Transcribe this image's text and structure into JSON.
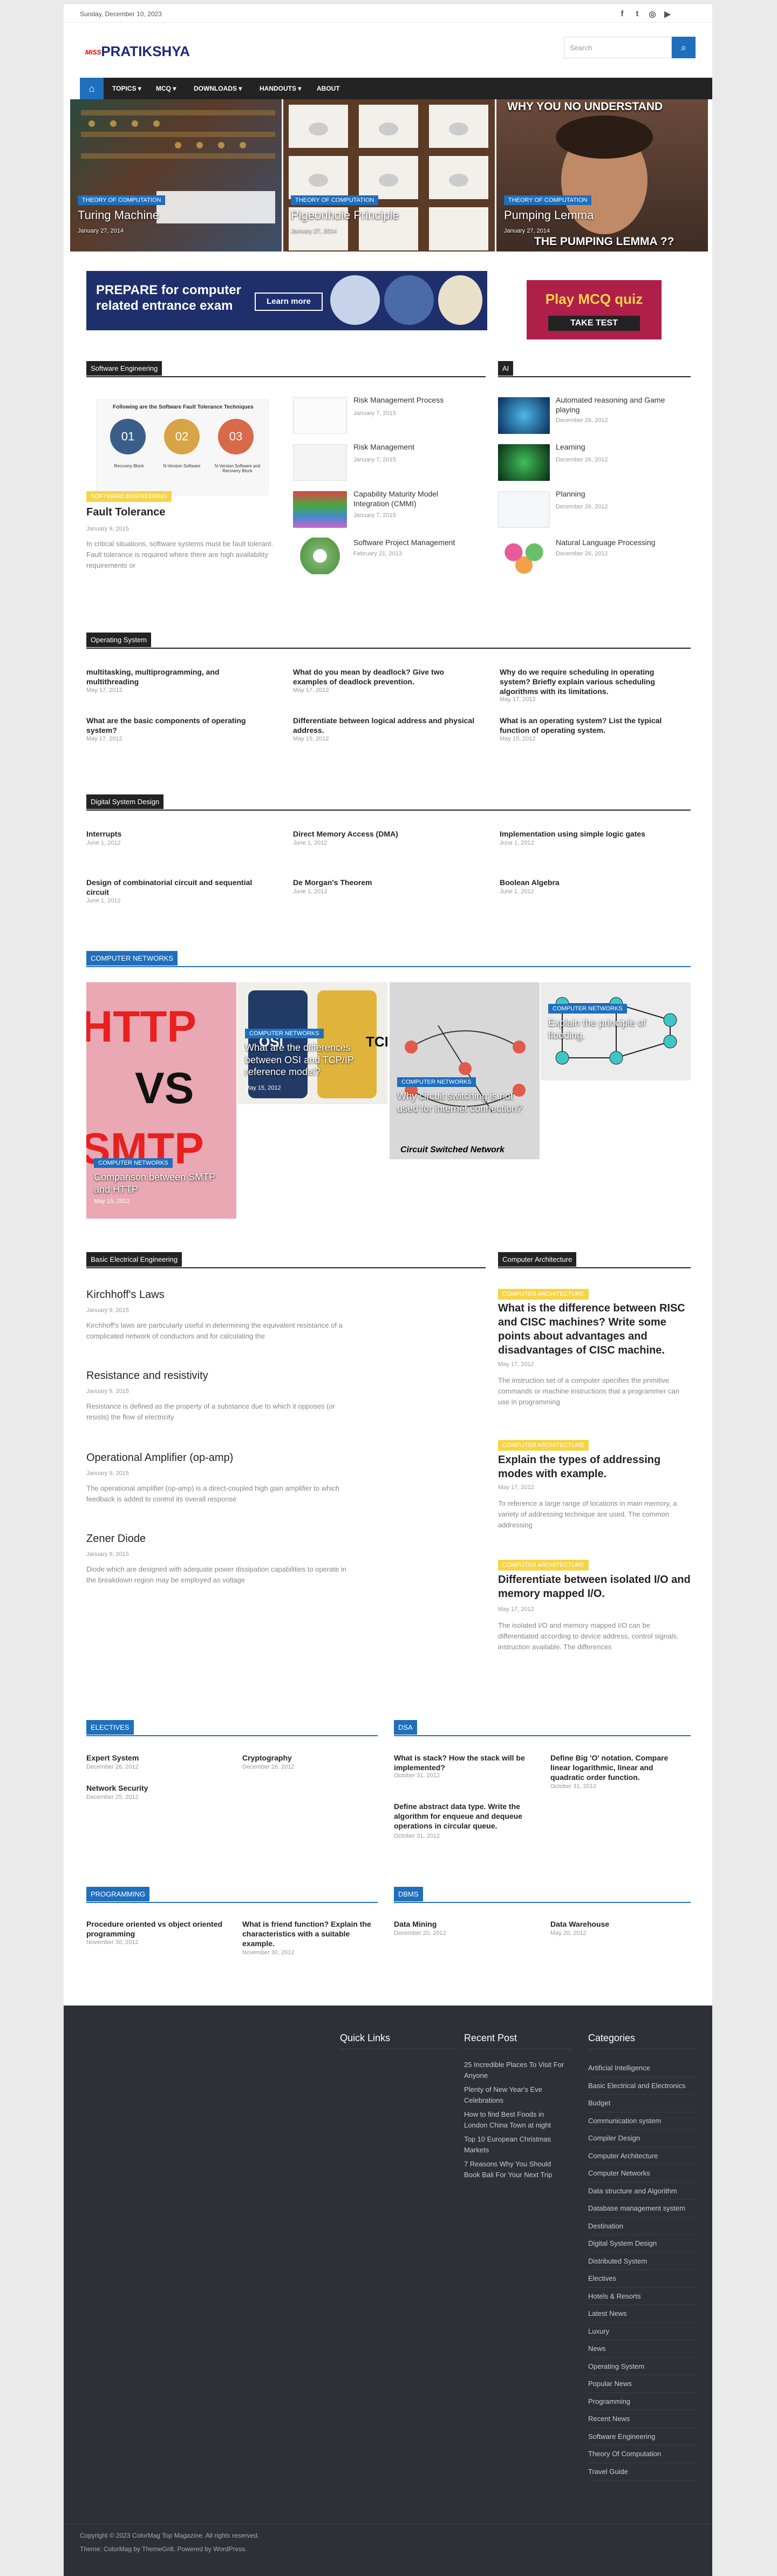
{
  "topbar": {
    "date": "Sunday, December 10, 2023",
    "social": [
      "facebook-icon",
      "twitter-icon",
      "instagram-icon",
      "youtube-icon"
    ]
  },
  "brand": {
    "logo_small": "MISS",
    "logo": "PRATIKSHYA"
  },
  "search": {
    "placeholder": "Search"
  },
  "nav": [
    "TOPICS",
    "MCQ",
    "DOWNLOADS",
    "HANDOUTS",
    "ABOUT"
  ],
  "slider": [
    {
      "cat": "THEORY OF COMPUTATION",
      "title": "Turing Machine",
      "date": "January 27, 2014"
    },
    {
      "cat": "THEORY OF COMPUTATION",
      "title": "Pigeonhole Principle",
      "date": "January 27, 2014"
    },
    {
      "cat": "THEORY OF COMPUTATION",
      "title": "Pumping Lemma",
      "date": "January 27, 2014",
      "img_text": "WHY YOU NO UNDERSTAND",
      "img_text2": "THE PUMPING LEMMA ??"
    }
  ],
  "ads": {
    "banner1": "PREPARE for computer related entrance exam",
    "banner1_btn": "Learn more",
    "banner2": "Play MCQ quiz",
    "banner2_btn": "TAKE TEST"
  },
  "se": {
    "title": "Software Engineering",
    "main": {
      "tag": "SOFTWARE ENGINEERING",
      "title": "Fault Tolerance",
      "date": "January 9, 2015",
      "excerpt": "In critical situations, software systems must be fault tolerant. Fault tolerance is required where there are high availability requirements or",
      "img_title": "Following are the Software Fault Tolerance Techniques",
      "img_labels": [
        "Recovery Block",
        "N-Version Software",
        "N-Version Software and Recovery Block"
      ],
      "img_nums": [
        "01",
        "02",
        "03"
      ]
    },
    "items": [
      {
        "title": "Risk Management Process",
        "date": "January 7, 2015"
      },
      {
        "title": "Risk Management",
        "date": "January 7, 2015"
      },
      {
        "title": "Capability Maturity Model Integration (CMMI)",
        "date": "January 7, 2015"
      },
      {
        "title": "Software Project Management",
        "date": "February 21, 2013"
      }
    ]
  },
  "ai": {
    "title": "AI",
    "items": [
      {
        "title": "Automated reasoning and Game playing",
        "date": "December 26, 2012"
      },
      {
        "title": "Learning",
        "date": "December 26, 2012"
      },
      {
        "title": "Planning",
        "date": "December 26, 2012"
      },
      {
        "title": "Natural Language Processing",
        "date": "December 26, 2012"
      }
    ]
  },
  "os": {
    "title": "Operating System",
    "items": [
      {
        "title": "multitasking, multiprogramming, and multithreading",
        "date": "May 17, 2012"
      },
      {
        "title": "What do you mean by deadlock? Give two examples of deadlock prevention.",
        "date": "May 17, 2012"
      },
      {
        "title": "Why do we require scheduling in operating system? Briefly explain various scheduling algorithms with its limitations.",
        "date": "May 17, 2012"
      },
      {
        "title": "What are the basic components of operating system?",
        "date": "May 17, 2012"
      },
      {
        "title": "Differentiate between logical address and physical address.",
        "date": "May 15, 2012"
      },
      {
        "title": "What is an operating system? List the typical function of operating system.",
        "date": "May 15, 2012"
      }
    ]
  },
  "dsd": {
    "title": "Digital System Design",
    "items": [
      {
        "title": "Interrupts",
        "date": "June 1, 2012"
      },
      {
        "title": "Direct Memory Access (DMA)",
        "date": "June 1, 2012"
      },
      {
        "title": "Implementation using simple logic gates",
        "date": "June 1, 2012"
      },
      {
        "title": "Design of combinatorial circuit and sequential circuit",
        "date": "June 1, 2012"
      },
      {
        "title": "De Morgan's Theorem",
        "date": "June 1, 2012"
      },
      {
        "title": "Boolean Algebra",
        "date": "June 1, 2012"
      }
    ]
  },
  "cn": {
    "title": "COMPUTER NETWORKS",
    "items": [
      {
        "cat": "COMPUTER NETWORKS",
        "title": "Comparison between SMTP and HTTP",
        "date": "May 15, 2012",
        "img_top": "HTTP",
        "img_mid": "VS",
        "img_bot": "SMTP"
      },
      {
        "cat": "COMPUTER NETWORKS",
        "title": "What are the differences between OSI and TCP/IP reference model?",
        "date": "May 15, 2012",
        "img_a": "OSI",
        "img_b": "TCP"
      },
      {
        "cat": "COMPUTER NETWORKS",
        "title": "Why circuit switching is not used for internet connection?",
        "date": "May 15, 2012",
        "img_caption": "Circuit Switched Network"
      },
      {
        "cat": "COMPUTER NETWORKS",
        "title": "Explain the principle of flooding.",
        "date": "May 15, 2012"
      }
    ]
  },
  "bee": {
    "title": "Basic Electrical Engineering",
    "items": [
      {
        "title": "Kirchhoff's Laws",
        "date": "January 9, 2015",
        "excerpt": "Kirchhoff's laws are particularly useful in determining the equivalent resistance of a complicated network of conductors and for calculating the"
      },
      {
        "title": "Resistance and resistivity",
        "date": "January 9, 2015",
        "excerpt": "Resistance is defined as the property of a substance due to which it opposes (or resists) the flow of electricity"
      },
      {
        "title": "Operational Amplifier (op-amp)",
        "date": "January 9, 2015",
        "excerpt": "The operational amplifier (op-amp) is a direct-coupled high gain amplifier to which feedback is added to control its overall response"
      },
      {
        "title": "Zener Diode",
        "date": "January 9, 2015",
        "excerpt": "Diode which are designed with adequate power dissipation capabilities to operate in the breakdown region may be employed as voltage"
      }
    ]
  },
  "ca": {
    "title": "Computer Architecture",
    "items": [
      {
        "tag": "COMPUTER ARCHITECTURE",
        "title": "What is the difference between RISC and CISC machines? Write some points about advantages and disadvantages of CISC machine.",
        "date": "May 17, 2012",
        "excerpt": "The instruction set of a computer specifies the primitive commands or machine instructions that a programmer can use in programming"
      },
      {
        "tag": "COMPUTER ARCHITECTURE",
        "title": "Explain the types of addressing modes with example.",
        "date": "May 17, 2012",
        "excerpt": "To reference a large range of locations in main memory, a variety of addressing technique are used. The common addressing"
      },
      {
        "tag": "COMPUTER ARCHITECTURE",
        "title": "Differentiate between isolated I/O and memory mapped I/O.",
        "date": "May 17, 2012",
        "excerpt": "The  isolated I/O  and memory mapped I/O can be differentiated according to device address, control signals, instruction available. The differences"
      }
    ]
  },
  "electives": {
    "title": "ELECTIVES",
    "items": [
      {
        "title": "Expert System",
        "date": "December 26, 2012"
      },
      {
        "title": "Cryptography",
        "date": "December 26, 2012"
      },
      {
        "title": "Network Security",
        "date": "December 25, 2012"
      }
    ]
  },
  "dsa": {
    "title": "DSA",
    "items": [
      {
        "title": "What is stack? How the stack will be implemented?",
        "date": "October 31, 2012"
      },
      {
        "title": "Define Big 'O' notation. Compare linear logarithmic, linear and quadratic order function.",
        "date": "October 31, 2012"
      },
      {
        "title": "Define abstract data type. Write the algorithm for enqueue and dequeue operations in circular queue.",
        "date": "October 31, 2012"
      }
    ]
  },
  "prog": {
    "title": "PROGRAMMING",
    "items": [
      {
        "title": "Procedure oriented vs object oriented programming",
        "date": "November 30, 2012"
      },
      {
        "title": "What is friend function? Explain the characteristics with a suitable example.",
        "date": "November 30, 2012"
      }
    ]
  },
  "dbms": {
    "title": "DBMS",
    "items": [
      {
        "title": "Data Mining",
        "date": "December 20, 2012"
      },
      {
        "title": "Data Warehouse",
        "date": "May 20, 2012"
      }
    ]
  },
  "footer": {
    "quick": "Quick Links",
    "recent": "Recent Post",
    "cats": "Categories",
    "recent_items": [
      "25 Incredible Places To Visit For Anyone",
      "Plenty of New Year's Eve Celebrations",
      "How to find Best Foods in London China Town at night",
      "Top 10 European Christmas Markets",
      "7 Reasons Why You Should Book Bali For Your Next Trip"
    ],
    "cat_items": [
      "Artificial Intelligence",
      "Basic Electrical and Electronics",
      "Budget",
      "Communication system",
      "Compiler Design",
      "Computer Architecture",
      "Computer Networks",
      "Data structure and Algorithm",
      "Database management system",
      "Destination",
      "Digital System Design",
      "Distributed System",
      "Electives",
      "Hotels & Resorts",
      "Latest News",
      "Luxury",
      "News",
      "Operating System",
      "Popular News",
      "Programming",
      "Recent News",
      "Software Engineering",
      "Theory Of Computation",
      "Travel Guide"
    ],
    "copyright": "Copyright © 2023 ColorMag Top Magazine. All rights reserved.",
    "theme": "Theme: ColorMag by ThemeGrill. Powered by WordPress."
  },
  "colors": {
    "accent": "#1f6fbd",
    "dark": "#232323",
    "yellow": "#f5d547",
    "footer": "#2d3037"
  }
}
